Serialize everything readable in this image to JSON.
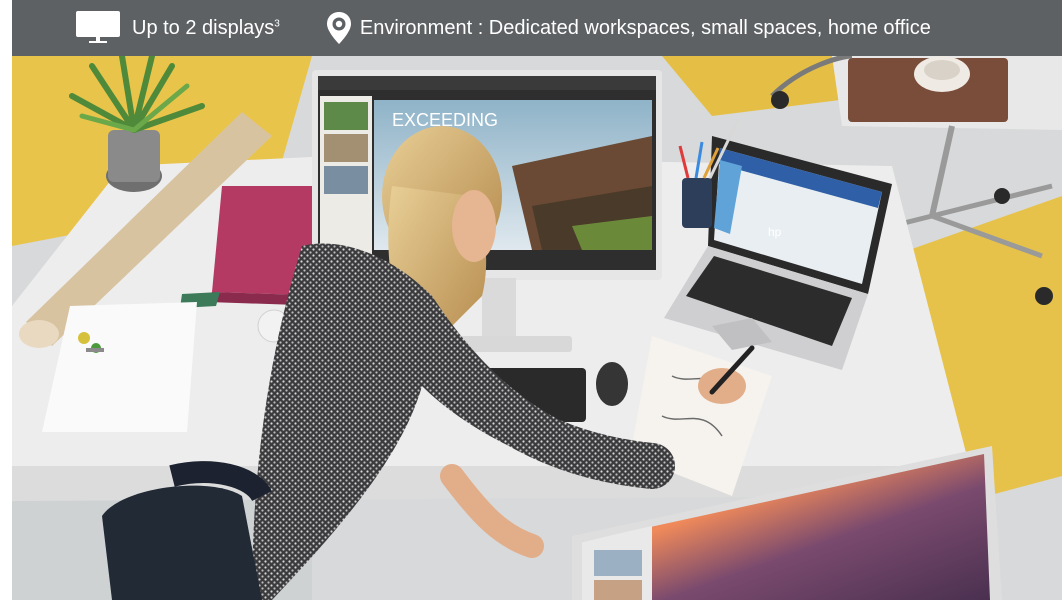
{
  "header": {
    "displays_text": "Up to 2 displays",
    "displays_footnote": "3",
    "environment_text": "Environment : Dedicated workspaces, small spaces, home office",
    "icons": {
      "displays": "monitor-icon",
      "environment": "location-pin-icon"
    }
  },
  "photo": {
    "screen_text": "EXCEEDING",
    "laptop_brand": "hp"
  },
  "colors": {
    "bar": "#5d6164",
    "floor_yellow": "#e9c44a",
    "desk": "#ececec"
  }
}
